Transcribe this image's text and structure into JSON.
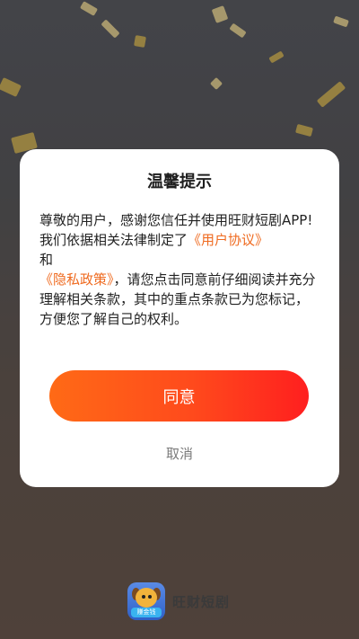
{
  "dialog": {
    "title": "温馨提示",
    "intro": "尊敬的用户，感谢您信任并使用旺财短剧APP!",
    "line_prefix": "我们依据相关法律制定了",
    "user_agreement": "《用户协议》",
    "and_text": "和",
    "privacy_policy": "《隐私政策》",
    "line_suffix": "，请您点击同意前仔细阅读并充分理解相关条款，其中的重点条款已为您标记，方便您了解自己的权利。",
    "agree_label": "同意",
    "cancel_label": "取消"
  },
  "brand": {
    "name": "旺财短剧",
    "icon_badge": "赚金钱"
  },
  "colors": {
    "accent_link": "#ef6a1f",
    "button_gradient_start": "#ff6a16",
    "button_gradient_end": "#ff1f1f"
  }
}
